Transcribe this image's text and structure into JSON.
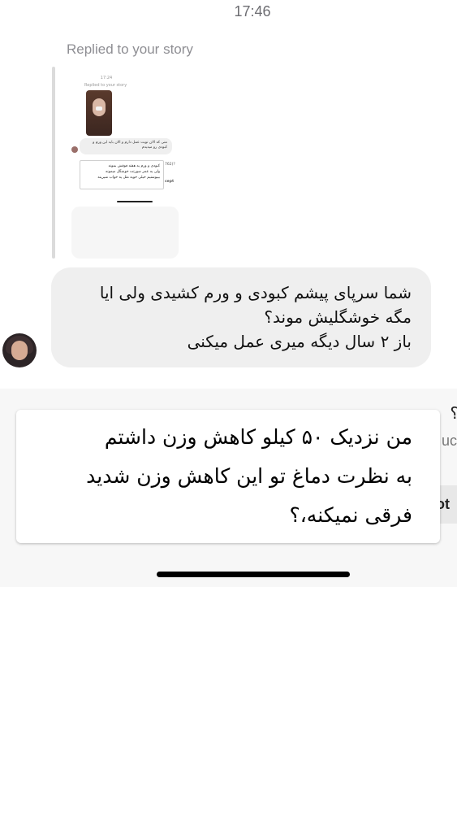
{
  "status_bar": {
    "time": "17:46"
  },
  "story_reply": {
    "label": "Replied to your story",
    "thumbnail": {
      "time": "17:24",
      "replied_label": "Replied to your story",
      "bubble_text": "منی که الان نوبت عمل دارم و الان باید این ورم و کبودی رو میدیدم",
      "overlay_lines": [
        "کبودی و ورم یه هفته فوقش بمونه",
        "ولی یه عمر صورتت خوشگل میمونه",
        "بیبوشتیم خیلی خوبه مثل یه خواب شیرینه"
      ],
      "side_text": "762)?",
      "accept_label": "cept"
    }
  },
  "message": {
    "lines": [
      "شما سرپای پیشم کبودی و ورم کشیدی ولی ایا",
      "مگه خوشگلیش موند؟",
      "باز ۲ سال دیگه میری عمل میکنی"
    ]
  },
  "caption": {
    "lines": [
      "من نزدیک ۵۰ کیلو کاهش وزن داشتم",
      "به نظرت دماغ تو این کاهش وزن شدید",
      "فرقی نمیکنه،؟"
    ]
  },
  "background_fragments": {
    "right_1": "؟",
    "right_2": "uc",
    "right_3": "ot"
  },
  "colors": {
    "bubble": "#efefef",
    "muted_text": "#8e8e93",
    "caption_bg": "#ffffff"
  }
}
